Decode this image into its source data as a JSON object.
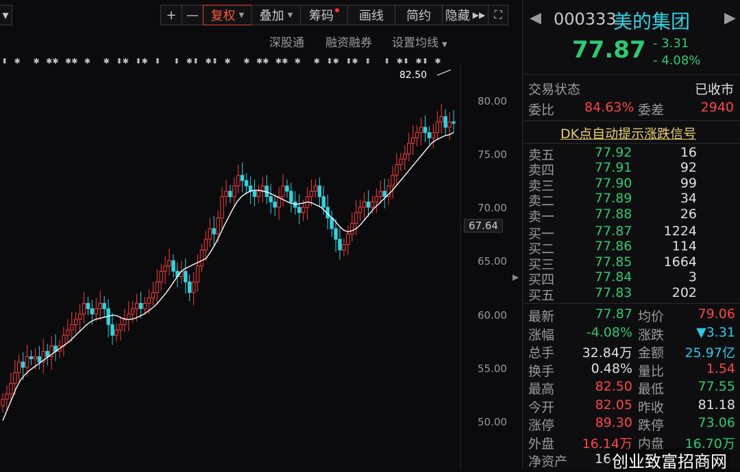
{
  "toolbar": {
    "plus": "+",
    "minus": "—",
    "fuquan": "复权",
    "diejia": "叠加",
    "chouma": "筹码",
    "huaxian": "画线",
    "jianyue": "简约",
    "yincang": "隐藏",
    "expand_icon": "expand-icon"
  },
  "subbar": {
    "shengutong": "深股通",
    "rongzi": "融资融券",
    "set_ma": "设置均线"
  },
  "chart_labels": {
    "price_axis": [
      "80.00",
      "75.00",
      "70.00",
      "67.64",
      "65.00",
      "60.00",
      "55.00",
      "50.00"
    ],
    "high_marker": "82.50"
  },
  "chart_data": {
    "type": "candlestick",
    "y_ticks": [
      80,
      75,
      70,
      65,
      60,
      55,
      50
    ],
    "ylim": [
      48,
      84
    ],
    "current_price_tag": 67.64,
    "high_annotation": 82.5,
    "series": [
      {
        "name": "K",
        "values": [
          52,
          52.5,
          53.5,
          54.5,
          55.5,
          55,
          56,
          55.8,
          56,
          55.5,
          56.5,
          56,
          57,
          56.5,
          57,
          58,
          58.5,
          59,
          59.5,
          60,
          61,
          60.5,
          60,
          60.5,
          61,
          60.5,
          59,
          58,
          58.5,
          59,
          59.5,
          60,
          60.5,
          61,
          60.5,
          61,
          61.5,
          62,
          63,
          64,
          64.5,
          65,
          64,
          63.5,
          64,
          63,
          62,
          63,
          64.5,
          66,
          67,
          68,
          67.5,
          69,
          71,
          71.5,
          71,
          72,
          73,
          72.5,
          72,
          71.5,
          71,
          71.5,
          72,
          71,
          70.5,
          70,
          71,
          72,
          71.5,
          70.5,
          70,
          69.5,
          70,
          71,
          71.5,
          72,
          71,
          70,
          69,
          68,
          67,
          66,
          66.5,
          67.5,
          68.5,
          69.5,
          70,
          70.5,
          70,
          70.5,
          71,
          71.5,
          71,
          72,
          73,
          74,
          74.5,
          75,
          76,
          76.5,
          77,
          77.5,
          77,
          76.5,
          77,
          78,
          78.5,
          77.5,
          78,
          77.87
        ]
      },
      {
        "name": "MA",
        "values": [
          50,
          51,
          52,
          53,
          53.8,
          54.3,
          54.7,
          55,
          55.3,
          55.6,
          55.9,
          56.2,
          56.5,
          56.8,
          57.1,
          57.4,
          57.8,
          58.2,
          58.6,
          59,
          59.3,
          59.5,
          59.6,
          59.7,
          59.8,
          59.9,
          59.8,
          59.6,
          59.5,
          59.5,
          59.6,
          59.8,
          60,
          60.3,
          60.6,
          61,
          61.5,
          62,
          62.6,
          63.2,
          63.8,
          64.2,
          64.4,
          64.6,
          64.8,
          65,
          65.2,
          65.8,
          66.5,
          67.3,
          68.2,
          69,
          69.8,
          70.5,
          71,
          71.3,
          71.5,
          71.6,
          71.6,
          71.5,
          71.4,
          71.2,
          71,
          70.8,
          70.6,
          70.4,
          70.3,
          70.3,
          70.4,
          70.5,
          70.4,
          70.2,
          70,
          69.6,
          69.2,
          68.8,
          68.3,
          67.9,
          67.7,
          67.8,
          68,
          68.4,
          68.9,
          69.4,
          69.9,
          70.3,
          70.7,
          71.1,
          71.5,
          72,
          72.5,
          73,
          73.5,
          74,
          74.5,
          75,
          75.5,
          76,
          76.3,
          76.5,
          76.7,
          76.8,
          77
        ]
      }
    ]
  },
  "side": {
    "code": "000333",
    "name": "美的集团",
    "price": "77.87",
    "change": "- 3.31",
    "pct": "- 4.08%",
    "status_label": "交易状态",
    "status_value": "已收市",
    "weibi_label": "委比",
    "weibi_value": "84.63%",
    "weicha_label": "委差",
    "weicha_value": "2940",
    "dk_link": "DK点自动提示涨跌信号",
    "sells": [
      {
        "label": "卖五",
        "price": "77.92",
        "vol": "16"
      },
      {
        "label": "卖四",
        "price": "77.91",
        "vol": "92"
      },
      {
        "label": "卖三",
        "price": "77.90",
        "vol": "99"
      },
      {
        "label": "卖二",
        "price": "77.89",
        "vol": "34"
      },
      {
        "label": "卖一",
        "price": "77.88",
        "vol": "26"
      }
    ],
    "buys": [
      {
        "label": "买一",
        "price": "77.87",
        "vol": "1224"
      },
      {
        "label": "买二",
        "price": "77.86",
        "vol": "114"
      },
      {
        "label": "买三",
        "price": "77.85",
        "vol": "1664"
      },
      {
        "label": "买四",
        "price": "77.84",
        "vol": "3"
      },
      {
        "label": "买五",
        "price": "77.83",
        "vol": "202"
      }
    ],
    "stats": [
      {
        "l1": "最新",
        "v1": "77.87",
        "c1": "g",
        "l2": "均价",
        "v2": "79.06",
        "c2": "r"
      },
      {
        "l1": "涨幅",
        "v1": "-4.08%",
        "c1": "g",
        "l2": "涨跌",
        "v2": "▼3.31",
        "c2": "c"
      },
      {
        "l1": "总手",
        "v1": "32.84万",
        "c1": "w",
        "l2": "金额",
        "v2": "25.97亿",
        "c2": "c"
      },
      {
        "l1": "换手",
        "v1": "0.48%",
        "c1": "w",
        "l2": "量比",
        "v2": "1.54",
        "c2": "r"
      },
      {
        "l1": "最高",
        "v1": "82.50",
        "c1": "r",
        "l2": "最低",
        "v2": "77.55",
        "c2": "g"
      },
      {
        "l1": "今开",
        "v1": "82.05",
        "c1": "r",
        "l2": "昨收",
        "v2": "81.18",
        "c2": "w"
      },
      {
        "l1": "涨停",
        "v1": "89.30",
        "c1": "r",
        "l2": "跌停",
        "v2": "73.06",
        "c2": "g"
      },
      {
        "l1": "外盘",
        "v1": "16.14万",
        "c1": "r",
        "l2": "内盘",
        "v2": "16.70万",
        "c2": "g"
      }
    ],
    "jzc_label": "净资产",
    "jzc_value": "16",
    "watermark": "创业致富招商网"
  }
}
